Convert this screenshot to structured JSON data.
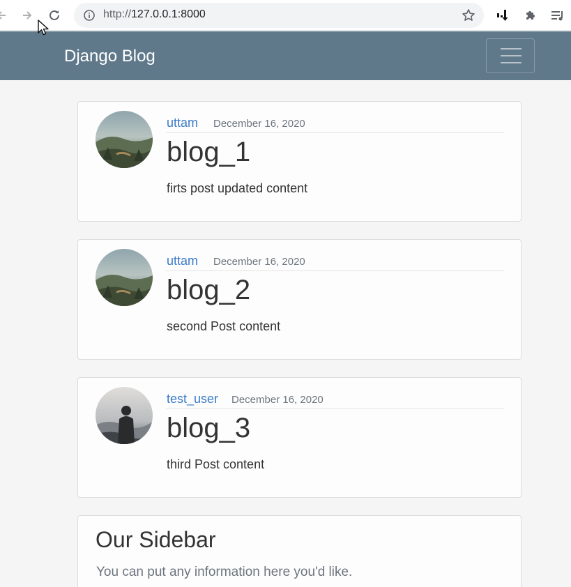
{
  "browser": {
    "url_scheme": "http://",
    "url_host": "127.0.0.1:8000",
    "icons": [
      "back-arrow-icon",
      "forward-arrow-icon",
      "reload-icon",
      "info-icon",
      "star-icon",
      "extension-icon",
      "puzzle-icon",
      "reading-list-icon"
    ]
  },
  "navbar": {
    "brand": "Django Blog",
    "color": "#5f788a"
  },
  "posts": [
    {
      "author": "uttam",
      "date": "December 16, 2020",
      "title": "blog_1",
      "content": "firts post updated content"
    },
    {
      "author": "uttam",
      "date": "December 16, 2020",
      "title": "blog_2",
      "content": "second Post content"
    },
    {
      "author": "test_user",
      "date": "December 16, 2020",
      "title": "blog_3",
      "content": "third Post content"
    }
  ],
  "sidebar": {
    "title": "Our Sidebar",
    "text": "You can put any information here you'd like."
  },
  "colors": {
    "link": "#3a7bc6",
    "muted": "#6c757d"
  }
}
